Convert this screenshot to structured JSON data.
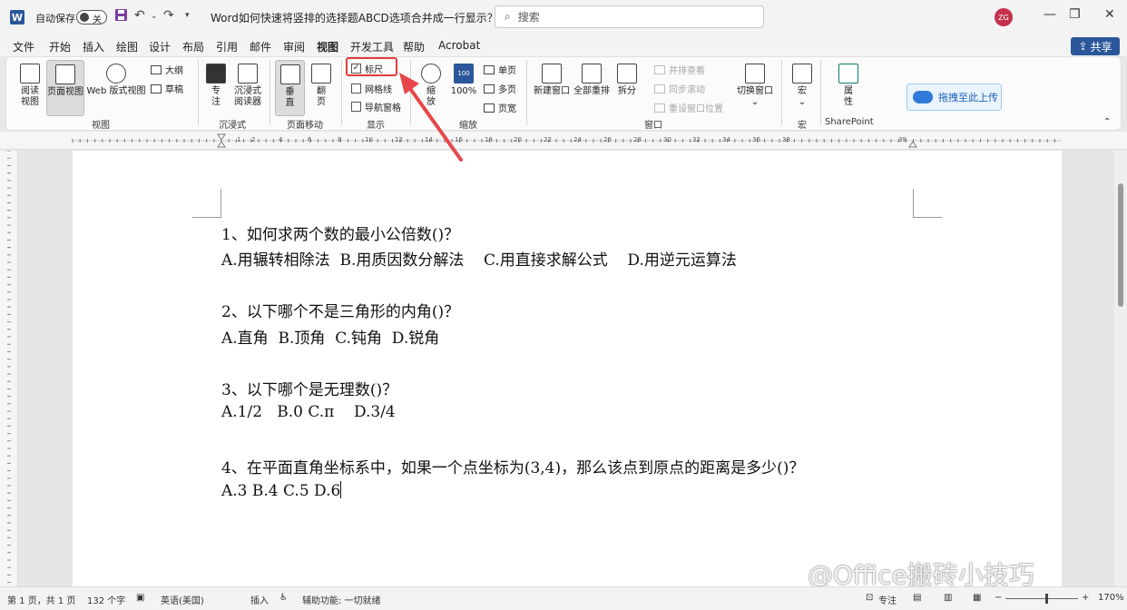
{
  "titlebar": {
    "app_logo": "W",
    "autosave_label": "自动保存",
    "autosave_state": "关",
    "document_title": "Word如何快速将竖排的选择题ABCD选项合并成一行显示？.d...",
    "search_placeholder": "搜索",
    "user_initials": "ZG"
  },
  "menubar": {
    "items": [
      "文件",
      "开始",
      "插入",
      "绘图",
      "设计",
      "布局",
      "引用",
      "邮件",
      "审阅",
      "视图",
      "开发工具",
      "帮助",
      "Acrobat"
    ],
    "active": "视图",
    "share_label": "共享"
  },
  "ribbon": {
    "view": {
      "read_mode": "阅读\n视图",
      "print_layout": "页面视图",
      "web_layout": "Web 版式视图",
      "outline": "大纲",
      "draft": "草稿",
      "group_label": "视图"
    },
    "immersive": {
      "focus": "专\n注",
      "immersive_reader": "沉浸式\n阅读器",
      "group_label": "沉浸式"
    },
    "page_movement": {
      "vertical": "垂\n直",
      "side_to_side": "翻\n页",
      "group_label": "页面移动"
    },
    "show": {
      "ruler": "标尺",
      "ruler_checked": true,
      "gridlines": "网格线",
      "nav_pane": "导航窗格",
      "group_label": "显示"
    },
    "zoom": {
      "zoom": "缩\n放",
      "hundred": "100%",
      "icon_text": "100",
      "one_page": "单页",
      "multiple_pages": "多页",
      "page_width": "页宽",
      "group_label": "缩放"
    },
    "window": {
      "new_window": "新建窗口",
      "arrange_all": "全部重排",
      "split": "拆分",
      "side_by_side": "并排查看",
      "sync_scroll": "同步滚动",
      "reset_position": "重设窗口位置",
      "switch_windows": "切换窗口",
      "group_label": "窗口"
    },
    "macros": {
      "macros": "宏",
      "group_label": "宏"
    },
    "sharepoint": {
      "properties": "属\n性",
      "group_label": "SharePoint"
    },
    "upload_label": "拖拽至此上传"
  },
  "ruler_numbers": [
    "1",
    "2",
    "4",
    "6",
    "8",
    "10",
    "12",
    "14",
    "16",
    "18",
    "20",
    "22",
    "24",
    "26",
    "28",
    "30",
    "32",
    "34",
    "36",
    "38",
    "39"
  ],
  "document": {
    "lines": [
      "1、如何求两个数的最小公倍数()？",
      "A.用辗转相除法  B.用质因数分解法    C.用直接求解公式    D.用逆元运算法",
      "2、以下哪个不是三角形的内角()？",
      "A.直角  B.顶角  C.钝角  D.锐角",
      "3、以下哪个是无理数()？",
      "A.1/2   B.0 C.π    D.3/4",
      "4、在平面直角坐标系中，如果一个点坐标为(3,4)，那么该点到原点的距离是多少()？",
      "A.3 B.4 C.5 D.6"
    ]
  },
  "statusbar": {
    "page": "第 1 页，共 1 页",
    "words": "132 个字",
    "language": "英语(美国)",
    "insert_mode": "插入",
    "accessibility": "辅助功能: 一切就绪",
    "focus": "专注",
    "zoom_level": "170%"
  },
  "watermark": "@Office搬砖小技巧",
  "colors": {
    "brand": "#2b579a",
    "highlight": "#e23b3b"
  }
}
